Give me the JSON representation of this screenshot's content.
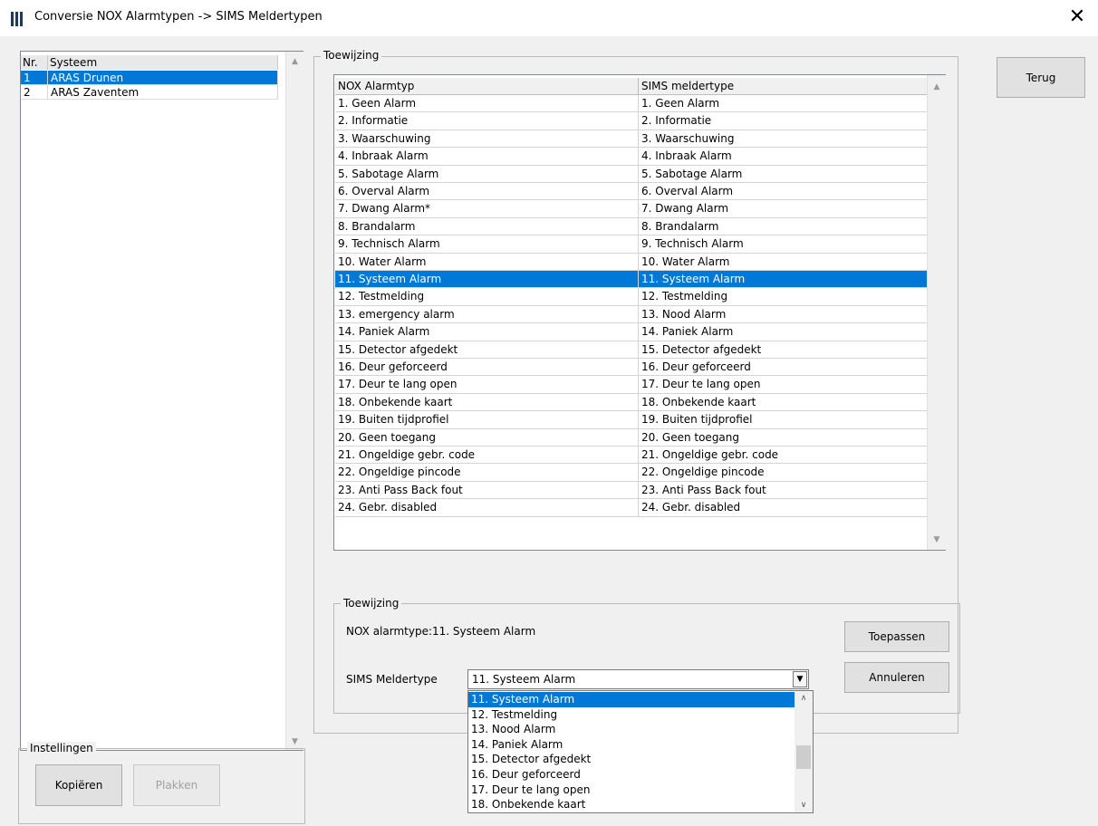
{
  "window": {
    "title": "Conversie NOX Alarmtypen -> SIMS Meldertypen",
    "close_glyph": "✕"
  },
  "systems": {
    "headers": [
      "Nr.",
      "Systeem"
    ],
    "rows": [
      {
        "nr": "1",
        "name": "ARAS Drunen",
        "selected": true
      },
      {
        "nr": "2",
        "name": "ARAS Zaventem",
        "selected": false
      }
    ]
  },
  "mapping_group": {
    "label": "Toewijzing",
    "headers": [
      "NOX Alarmtyp",
      "SIMS meldertype"
    ],
    "rows": [
      [
        "1. Geen Alarm",
        "1. Geen Alarm"
      ],
      [
        "2. Informatie",
        "2. Informatie"
      ],
      [
        "3. Waarschuwing",
        "3. Waarschuwing"
      ],
      [
        "4. Inbraak Alarm",
        "4. Inbraak Alarm"
      ],
      [
        "5. Sabotage Alarm",
        "5. Sabotage Alarm"
      ],
      [
        "6. Overval Alarm",
        "6. Overval Alarm"
      ],
      [
        "7. Dwang Alarm*",
        "7. Dwang Alarm"
      ],
      [
        "8. Brandalarm",
        "8. Brandalarm"
      ],
      [
        "9. Technisch Alarm",
        "9. Technisch Alarm"
      ],
      [
        "10. Water Alarm",
        "10. Water Alarm"
      ],
      [
        "11. Systeem Alarm",
        "11. Systeem Alarm"
      ],
      [
        "12. Testmelding",
        "12. Testmelding"
      ],
      [
        "13. emergency alarm",
        "13. Nood Alarm"
      ],
      [
        "14. Paniek Alarm",
        "14. Paniek Alarm"
      ],
      [
        "15. Detector afgedekt",
        "15. Detector afgedekt"
      ],
      [
        "16. Deur geforceerd",
        "16. Deur geforceerd"
      ],
      [
        "17. Deur te lang open",
        "17. Deur te lang open"
      ],
      [
        "18. Onbekende kaart",
        "18. Onbekende kaart"
      ],
      [
        "19. Buiten tijdprofiel",
        "19. Buiten tijdprofiel"
      ],
      [
        "20. Geen toegang",
        "20. Geen toegang"
      ],
      [
        "21. Ongeldige gebr. code",
        "21. Ongeldige gebr. code"
      ],
      [
        "22. Ongeldige pincode",
        "22. Ongeldige pincode"
      ],
      [
        "23. Anti Pass Back fout",
        "23. Anti Pass Back fout"
      ],
      [
        "24. Gebr. disabled",
        "24. Gebr. disabled"
      ]
    ],
    "selected_row": 10
  },
  "assign_group": {
    "label": "Toewijzing",
    "nox_label": "NOX alarmtype:",
    "nox_value": "11. Systeem Alarm",
    "sims_label": "SIMS Meldertype",
    "sims_selected": "11. Systeem Alarm",
    "dropdown_items": [
      "11. Systeem Alarm",
      "12. Testmelding",
      "13. Nood Alarm",
      "14. Paniek Alarm",
      "15. Detector afgedekt",
      "16. Deur geforceerd",
      "17. Deur te lang open",
      "18. Onbekende kaart"
    ],
    "apply_label": "Toepassen",
    "cancel_label": "Annuleren"
  },
  "back_label": "Terug",
  "settings_group": {
    "label": "Instellingen",
    "copy_label": "Kopiëren",
    "paste_label": "Plakken"
  },
  "colors": {
    "selection": "#0078d7",
    "window_bg": "#f0f0f0"
  }
}
